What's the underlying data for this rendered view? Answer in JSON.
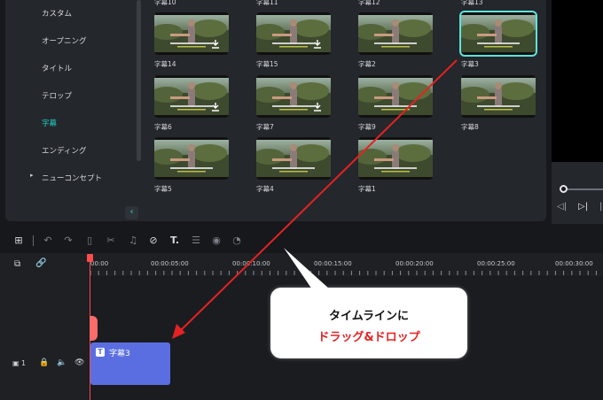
{
  "sidebar": {
    "items": [
      {
        "label": "カスタム",
        "active": false
      },
      {
        "label": "オープニング",
        "active": false
      },
      {
        "label": "タイトル",
        "active": false
      },
      {
        "label": "テロップ",
        "active": false
      },
      {
        "label": "字幕",
        "active": true
      },
      {
        "label": "エンディング",
        "active": false
      },
      {
        "label": "ニューコンセプト",
        "active": false,
        "expandable": true
      }
    ]
  },
  "grid": {
    "top_captions": [
      "字幕10",
      "字幕11",
      "字幕12",
      "字幕13"
    ],
    "rows": [
      [
        {
          "caption": "字幕14",
          "download": true
        },
        {
          "caption": "字幕15",
          "download": true
        },
        {
          "caption": "字幕2",
          "download": false
        },
        {
          "caption": "字幕3",
          "download": false,
          "selected": true
        }
      ],
      [
        {
          "caption": "字幕6",
          "download": true
        },
        {
          "caption": "字幕7",
          "download": true
        },
        {
          "caption": "字幕9",
          "download": false
        },
        {
          "caption": "字幕8",
          "download": false
        }
      ],
      [
        {
          "caption": "字幕5",
          "download": false
        },
        {
          "caption": "字幕4",
          "download": false
        },
        {
          "caption": "字幕1",
          "download": false
        }
      ]
    ]
  },
  "timeline": {
    "ruler_labels": [
      "00:00",
      "00:00:05:00",
      "00:00:10:00",
      "00:00:15:00",
      "00:00:20:00",
      "00:00:25:00",
      "00:00:30:00"
    ],
    "track_number": "1",
    "clip": {
      "label": "字幕3",
      "icon": "T"
    }
  },
  "callout": {
    "line1": "タイムラインに",
    "line2": "ドラッグ&ドロップ"
  },
  "colors": {
    "accent": "#22d3c5",
    "clip": "#5b6ee1",
    "arrow": "#e52222",
    "playhead": "#ff4b4b"
  }
}
